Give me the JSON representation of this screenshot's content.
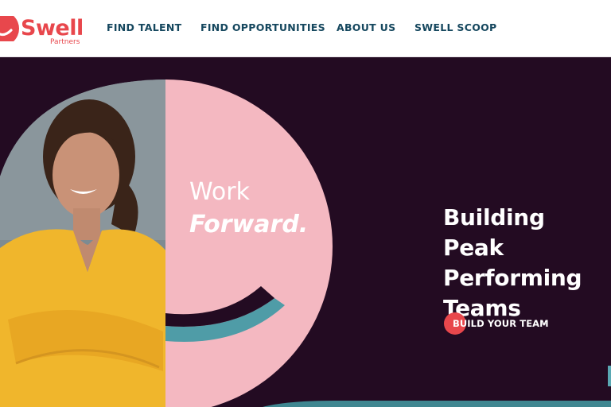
{
  "brand": {
    "name": "Swell",
    "subtitle": "Partners",
    "color": "#e8474c"
  },
  "nav": {
    "items": [
      {
        "label": "FIND TALENT"
      },
      {
        "label": "FIND OPPORTUNITIES"
      },
      {
        "label": "ABOUT US"
      },
      {
        "label": "SWELL SCOOP"
      }
    ],
    "color": "#15475e"
  },
  "hero": {
    "tagline_line1": "Work",
    "tagline_line2": "Forward.",
    "headline": "Building Peak Performing Teams",
    "cta_label": "BUILD YOUR TEAM",
    "cta_icon": "arrow-right-icon",
    "background": "#230b22",
    "accent_pink": "#f4b8c1",
    "accent_teal": "#4f9ca7"
  }
}
